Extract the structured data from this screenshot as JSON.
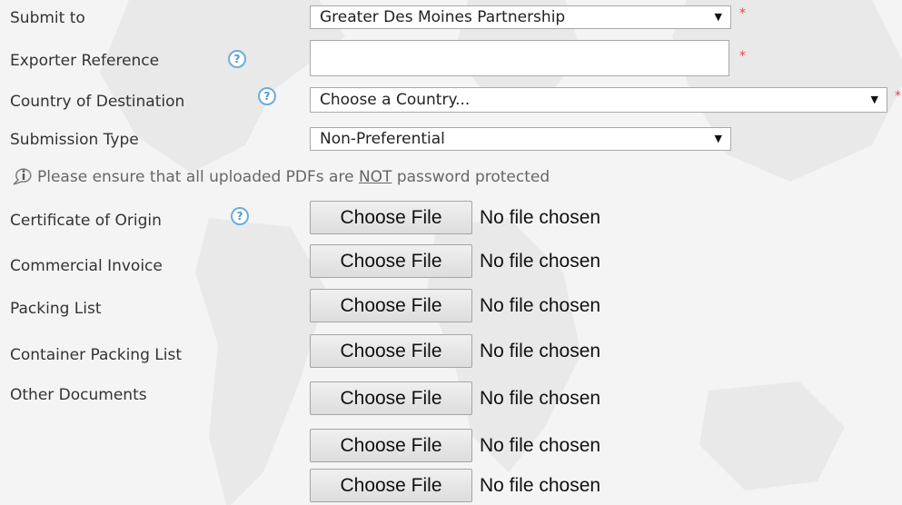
{
  "form": {
    "submit_to": {
      "label": "Submit to",
      "value": "Greater Des Moines Partnership",
      "required_mark": "*"
    },
    "exporter_reference": {
      "label": "Exporter Reference",
      "value": "",
      "required_mark": "*",
      "help_icon": "?"
    },
    "country_of_destination": {
      "label": "Country of Destination",
      "value": "Choose a Country...",
      "required_mark": "*",
      "help_icon": "?"
    },
    "submission_type": {
      "label": "Submission Type",
      "value": "Non-Preferential"
    },
    "notice": {
      "before": "Please ensure that all uploaded PDFs are ",
      "emphasis": "NOT",
      "after": " password protected"
    },
    "files": {
      "button_label": "Choose File",
      "status_text": "No file chosen",
      "certificate_of_origin": "Certificate of Origin",
      "commercial_invoice": "Commercial Invoice",
      "packing_list": "Packing List",
      "container_packing_list": "Container Packing List",
      "other_documents": "Other Documents"
    }
  },
  "colors": {
    "required": "#e0454b",
    "help_icon": "#4b97d2",
    "label_text": "#333333",
    "notice_text": "#666666"
  },
  "icons": {
    "help": "help-circle-icon",
    "info": "info-icon",
    "dropdown": "chevron-down-icon"
  }
}
